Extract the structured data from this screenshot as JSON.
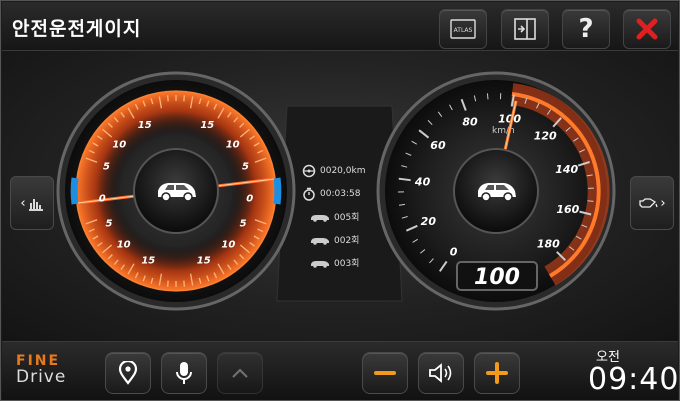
{
  "app": {
    "title": "안전운전게이지"
  },
  "toolbar": {
    "atlas_label": "ATLAS",
    "help_label": "?"
  },
  "left_gauge": {
    "ticks": [
      "15",
      "10",
      "5",
      "0",
      "5",
      "10",
      "15",
      "15",
      "10",
      "5",
      "0",
      "5",
      "10",
      "15"
    ],
    "accent_color": "#e8541c"
  },
  "right_gauge": {
    "unit": "km/h",
    "ticks": [
      "0",
      "20",
      "40",
      "60",
      "80",
      "100",
      "120",
      "140",
      "160",
      "180"
    ],
    "speed_value": "100",
    "needle_value": 100,
    "accent_color": "#e8541c"
  },
  "stats": {
    "distance": "0020,0km",
    "time": "00:03:58",
    "count1": "005회",
    "count2": "002회",
    "count3": "003회"
  },
  "brand": {
    "line1": "FINE",
    "line2": "Drive"
  },
  "clock": {
    "ampm": "오전",
    "time": "09:40"
  },
  "colors": {
    "accent": "#e8541c",
    "blue": "#1e8fe0",
    "plus_minus": "#f39a1a",
    "close": "#e02020"
  }
}
